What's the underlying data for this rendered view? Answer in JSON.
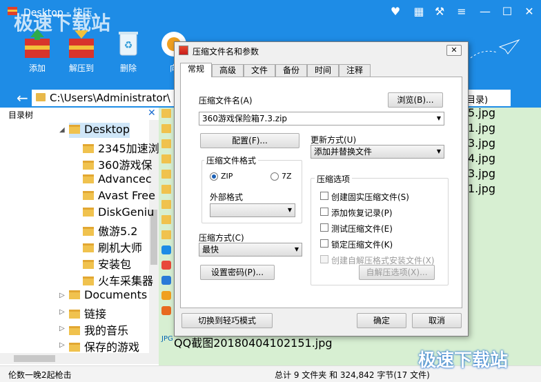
{
  "app": {
    "title": "Desktop - 快压",
    "watermark": "极速下载站",
    "toolbar": {
      "add": "添加",
      "extract": "解压到",
      "delete": "删除",
      "wizard": "向"
    },
    "address": "C:\\Users\\Administrator\\",
    "search_placeholder": "目录)",
    "tree": {
      "header": "目录树",
      "items": [
        {
          "label": "Desktop",
          "level": 0
        },
        {
          "label": "2345加速浏",
          "level": 1
        },
        {
          "label": "360游戏保",
          "level": 1
        },
        {
          "label": "Advancec",
          "level": 1
        },
        {
          "label": "Avast Free",
          "level": 1
        },
        {
          "label": "DiskGeniu",
          "level": 1
        },
        {
          "label": "傲游5.2",
          "level": 1
        },
        {
          "label": "刷机大师",
          "level": 1
        },
        {
          "label": "安装包",
          "level": 1
        },
        {
          "label": "火车采集器",
          "level": 1
        },
        {
          "label": "Documents",
          "level": 0
        },
        {
          "label": "链接",
          "level": 0
        },
        {
          "label": "我的音乐",
          "level": 0
        },
        {
          "label": "保存的游戏",
          "level": 0
        }
      ]
    },
    "files": [
      "5.jpg",
      "1.jpg",
      "3.jpg",
      "4.jpg",
      "3.jpg",
      "1.jpg"
    ],
    "qq_file": "QQ截图20180404102151.jpg",
    "status_left": "伦数一晚2起枪击",
    "status_right": "总计 9 文件夹  和  324,842 字节(17 文件)"
  },
  "dialog": {
    "title": "压缩文件名和参数",
    "close_label": "⌘",
    "tabs": [
      "常规",
      "高级",
      "文件",
      "备份",
      "时间",
      "注释"
    ],
    "archive_name_label": "压缩文件名(A)",
    "browse_button": "浏览(B)...",
    "archive_name_value": "360游戏保险箱7.3.zip",
    "config_button": "配置(F)...",
    "update_mode_label": "更新方式(U)",
    "update_mode_value": "添加并替换文件",
    "format_group": "压缩文件格式",
    "format_zip": "ZIP",
    "format_7z": "7Z",
    "external_format_label": "外部格式",
    "external_format_value": "",
    "options_group": "压缩选项",
    "options": [
      {
        "label": "创建固实压缩文件(S)",
        "checked": false,
        "disabled": false
      },
      {
        "label": "添加恢复记录(P)",
        "checked": false,
        "disabled": false
      },
      {
        "label": "测试压缩文件(E)",
        "checked": false,
        "disabled": false
      },
      {
        "label": "锁定压缩文件(K)",
        "checked": false,
        "disabled": false
      },
      {
        "label": "创建自解压格式安装文件(X)",
        "checked": false,
        "disabled": true
      }
    ],
    "method_label": "压缩方式(C)",
    "method_value": "最快",
    "password_button": "设置密码(P)...",
    "sfx_button": "自解压选项(X)...",
    "switch_mode_button": "切换到轻巧模式",
    "ok_button": "确定",
    "cancel_button": "取消"
  }
}
